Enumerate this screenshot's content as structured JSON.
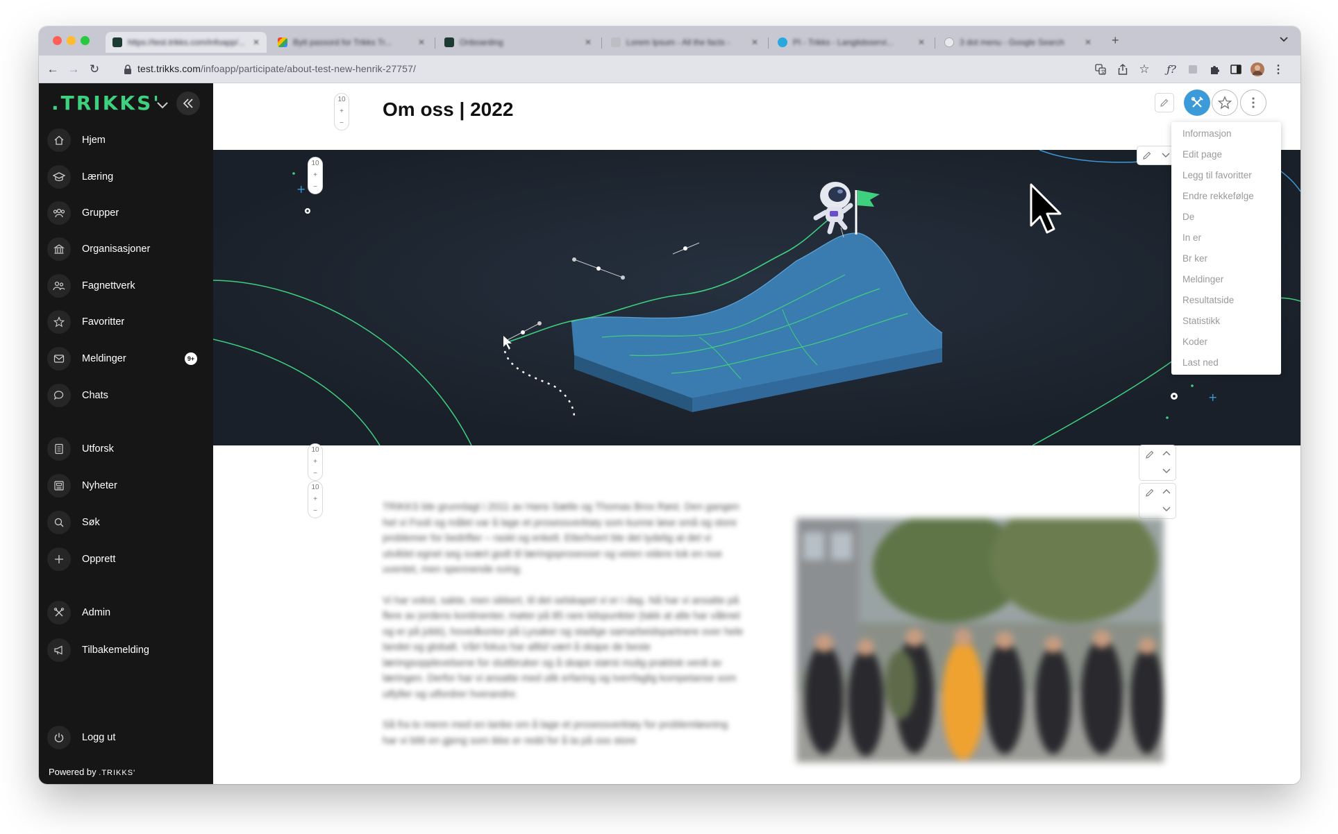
{
  "browser": {
    "tabs": [
      {
        "title": "https://test.trikks.com/infoapp/..."
      },
      {
        "title": "Bytt passord for Trikks Tr..."
      },
      {
        "title": "Onboarding"
      },
      {
        "title": "Lorem Ipsum - All the facts -"
      },
      {
        "title": "PI - Trikks - Langtidsservi..."
      },
      {
        "title": "3 dot menu - Google Search"
      }
    ],
    "url_host": "test.trikks.com",
    "url_path": "/infoapp/participate/about-test-new-henrik-27757/"
  },
  "sidebar": {
    "logo": ".TRIKKS'",
    "items": [
      {
        "label": "Hjem",
        "icon": "home-icon"
      },
      {
        "label": "Læring",
        "icon": "graduation-cap-icon"
      },
      {
        "label": "Grupper",
        "icon": "groups-icon"
      },
      {
        "label": "Organisasjoner",
        "icon": "building-icon"
      },
      {
        "label": "Fagnettverk",
        "icon": "network-icon"
      },
      {
        "label": "Favoritter",
        "icon": "star-icon"
      },
      {
        "label": "Meldinger",
        "icon": "mail-icon",
        "badge": "9+"
      },
      {
        "label": "Chats",
        "icon": "chat-icon"
      },
      {
        "label": "Utforsk",
        "icon": "book-icon"
      },
      {
        "label": "Nyheter",
        "icon": "newspaper-icon"
      },
      {
        "label": "Søk",
        "icon": "search-icon"
      },
      {
        "label": "Opprett",
        "icon": "plus-icon"
      },
      {
        "label": "Admin",
        "icon": "tools-icon"
      },
      {
        "label": "Tilbakemelding",
        "icon": "megaphone-icon"
      }
    ],
    "logout": "Logg ut",
    "powered_by": "Powered by",
    "powered_logo": ".TRIKKS'"
  },
  "main": {
    "title": "Om oss | 2022",
    "stepper": {
      "value": "10",
      "plus": "+",
      "minus": "−"
    },
    "menu": [
      "Informasjon",
      "Edit page",
      "Legg til favoritter",
      "Endre rekkefølge",
      "De",
      "In         er",
      "Br   ker",
      "Meldinger",
      "Resultatside",
      "Statistikk",
      "Koder",
      "Last ned"
    ],
    "body_paragraphs": [
      "TRIKKS ble grunnlagt i 2011 av Hans Sætle og Thomas Brox Røst. Den gangen het vi Fooli og målet var å lage et prosessverktøy som kunne løse små og store problemer for bedrifter – raskt og enkelt. Etterhvert ble det tydelig at det vi utviklet egnet seg svært godt til læringsprosesser og veien videre tok en noe uventet, men spennende sving.",
      "Vi har vokst, sakte, men sikkert, til det selskapet vi er i dag. Nå har vi ansatte på flere av jordens kontinenter, møter på 85 rare tidspunkter (takk at alle har våknet og er på jobb), hovedkontor på Lysaker og stadige samarbeidspartnere over hele landet og globalt. Vårt fokus har alltid vært å skape de beste læringsopplevelsene for sluttbruker og å skape størst mulig praktisk verdi av læringen. Derfor har vi ansatte med ulik erfaring og tverrfaglig kompetanse som utfyller og utfordrer hverandre.",
      "Så fra to menn med en tanke om å lage et prosessverktøy for problemløsning har vi blitt en gjeng som ikke er redd for å ta på oss store"
    ]
  },
  "colors": {
    "brand_green": "#3fd07f",
    "admin_blue": "#3d9ad8",
    "hero_bg": "#1d2530",
    "sidebar_bg": "#161616"
  }
}
